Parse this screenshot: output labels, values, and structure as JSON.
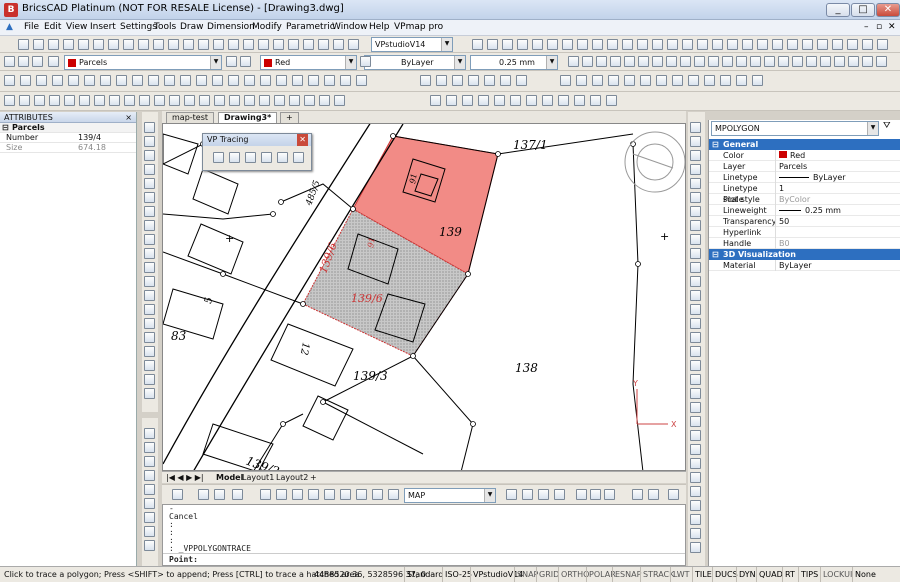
{
  "title": "BricsCAD Platinum (NOT FOR RESALE License) - [Drawing3.dwg]",
  "app_icon": "B",
  "window_buttons": [
    "_",
    "□",
    "✕"
  ],
  "menus": [
    "File",
    "Edit",
    "View",
    "Insert",
    "Settings",
    "Tools",
    "Draw",
    "Dimension",
    "Modify",
    "Parametric",
    "Window",
    "Help",
    "VPmap pro"
  ],
  "toolbar": {
    "style_combo": "VPstudioV14",
    "layer_combo": "Parcels",
    "color_combo": "Red",
    "linetype_combo": "ByLayer",
    "lineweight_combo": "0.25 mm"
  },
  "attributes_panel": {
    "title": "ATTRIBUTES",
    "group": "Parcels",
    "rows": [
      {
        "k": "Number",
        "v": "139/4"
      },
      {
        "k": "Size",
        "v": "674.18"
      }
    ]
  },
  "doc_tabs": [
    "map-test",
    "Drawing3*",
    "+"
  ],
  "vp_tracing": {
    "title": "VP Tracing",
    "close": "✕"
  },
  "map_labels": {
    "p137_1": "137/1",
    "p139": "139",
    "p139_6": "139/6",
    "p139_6b": "139/6",
    "p138": "138",
    "p139_3": "139/3",
    "p139_2": "139/2",
    "p83": "83",
    "p485_5": "485/5",
    "p5": "5",
    "p12": "12",
    "p91": "91",
    "p91b": "91",
    "ucs_y": "Y",
    "ucs_x": "X"
  },
  "layout_tabs": [
    "Model",
    "Layout1",
    "Layout2",
    "+"
  ],
  "snap_layer_combo": "MAP",
  "command_lines": [
    "-",
    "Cancel",
    ":",
    ":",
    ":",
    ": _VPPOLYGONTRACE"
  ],
  "command_prompt": "Point:",
  "properties": {
    "entity": "MPOLYGON",
    "general_title": "General",
    "rows": [
      {
        "k": "Color",
        "v": "Red",
        "swatch": "#cc0000"
      },
      {
        "k": "Layer",
        "v": "Parcels"
      },
      {
        "k": "Linetype",
        "v": "ByLayer"
      },
      {
        "k": "Linetype scale",
        "v": "1"
      },
      {
        "k": "Plot style",
        "v": "ByColor"
      },
      {
        "k": "Lineweight",
        "v": "0.25 mm"
      },
      {
        "k": "Transparency",
        "v": "50"
      },
      {
        "k": "Hyperlink",
        "v": ""
      },
      {
        "k": "Handle",
        "v": "B0"
      }
    ],
    "viz_title": "3D Visualization",
    "viz_rows": [
      {
        "k": "Material",
        "v": "ByLayer"
      }
    ]
  },
  "status": {
    "hint": "Click to trace a polygon; Press <SHIFT> to append; Press [CTRL] to trace a hatched area",
    "coords": "4488520.36, 5328596.37, 0",
    "toggles": [
      "Standard",
      "ISO-25",
      "VPstudioV14",
      "SNAP",
      "GRID",
      "ORTHO",
      "POLAR",
      "ESNAP",
      "STRACK",
      "LWT",
      "TILE",
      "DUCS",
      "DYN",
      "QUAD",
      "RT",
      "TIPS",
      "LOCKUI",
      "None"
    ]
  },
  "colors": {
    "accent": "#2d6fc0",
    "parcel_fill": "#f28b86",
    "hatch": "#b0b0b0"
  }
}
